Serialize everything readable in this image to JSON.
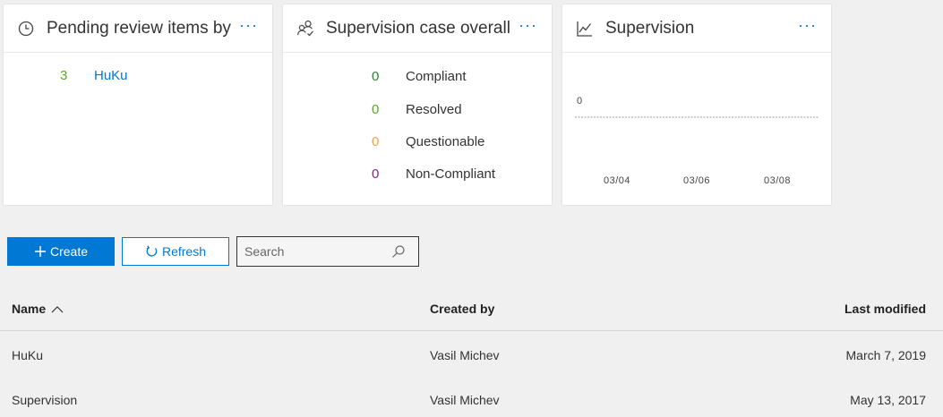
{
  "cards": {
    "pending": {
      "title": "Pending review items by ...",
      "more": "···",
      "rows": [
        {
          "count": "3",
          "name": "HuKu"
        }
      ],
      "count_color": "#5ba829",
      "name_color": "#0078d4"
    },
    "overall": {
      "title": "Supervision case overall ...",
      "more": "···",
      "rows": [
        {
          "count": "0",
          "label": "Compliant",
          "color": "#2e7d32"
        },
        {
          "count": "0",
          "label": "Resolved",
          "color": "#5ba829"
        },
        {
          "count": "0",
          "label": "Questionable",
          "color": "#f0a24a"
        },
        {
          "count": "0",
          "label": "Non-Compliant",
          "color": "#7b2a7b"
        }
      ]
    },
    "trend": {
      "title": "Supervision",
      "more": "···",
      "chart": {
        "value_label": "0",
        "x_ticks": [
          "03/04",
          "03/06",
          "03/08"
        ]
      }
    }
  },
  "toolbar": {
    "create_label": "Create",
    "refresh_label": "Refresh",
    "search_placeholder": "Search"
  },
  "table": {
    "columns": [
      "Name",
      "Created by",
      "Last modified"
    ],
    "sort_indicator": "ascending",
    "rows": [
      {
        "name": "HuKu",
        "created_by": "Vasil Michev",
        "modified": "March 7, 2019"
      },
      {
        "name": "Supervision",
        "created_by": "Vasil Michev",
        "modified": "May 13, 2017"
      }
    ]
  },
  "colors": {
    "accent": "#0078d4",
    "background": "#f0f0f0",
    "card": "#ffffff"
  }
}
